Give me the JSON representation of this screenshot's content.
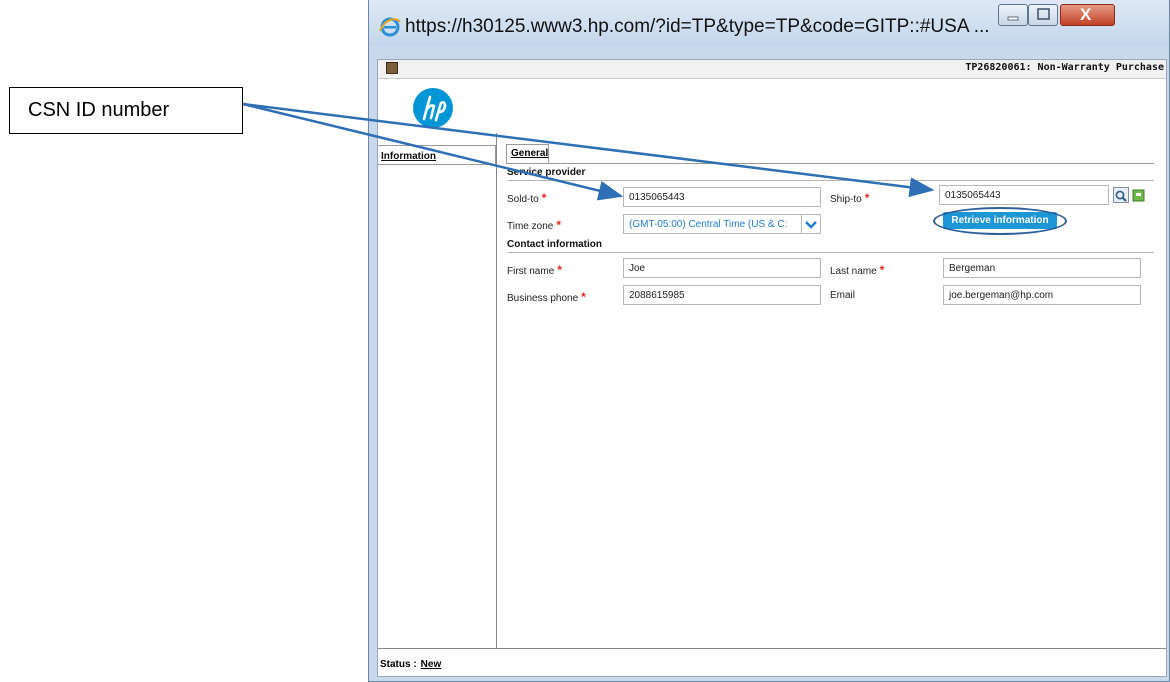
{
  "annotation": {
    "callout_text": "CSN ID number"
  },
  "window": {
    "url": "https://h30125.www3.hp.com/?id=TP&type=TP&code=GITP::#USA ...",
    "close_glyph": "X"
  },
  "page": {
    "document_title": "TP26820061: Non-Warranty Purchase",
    "side_tab": "Information",
    "tab": "General",
    "sections": {
      "service_provider": "Service provider",
      "contact_information": "Contact information"
    },
    "fields": {
      "sold_to": {
        "label": "Sold-to",
        "value": "0135065443"
      },
      "ship_to": {
        "label": "Ship-to",
        "value": "0135065443"
      },
      "time_zone": {
        "label": "Time zone",
        "value": "(GMT-05:00) Central Time (US & C:"
      },
      "first_name": {
        "label": "First name",
        "value": "Joe"
      },
      "last_name": {
        "label": "Last name",
        "value": "Bergeman"
      },
      "business_phone": {
        "label": "Business phone",
        "value": "2088615985"
      },
      "email": {
        "label": "Email",
        "value": "joe.bergeman@hp.com"
      }
    },
    "required_marker": "*",
    "retrieve_button": "Retrieve information",
    "status": {
      "label": "Status :",
      "value": "New"
    }
  },
  "colors": {
    "accent": "#1d96d6",
    "required": "#e4261a",
    "arrow": "#2e6fb5",
    "logo": "#0096d6"
  }
}
